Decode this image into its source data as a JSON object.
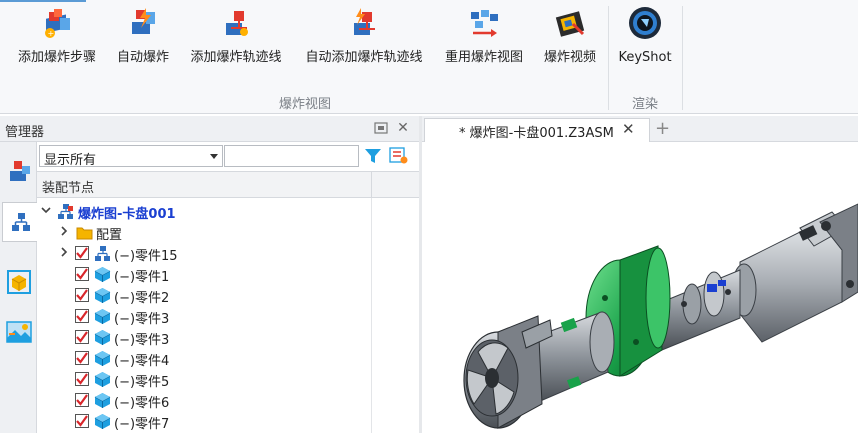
{
  "ribbon": {
    "buttons": [
      {
        "label": "添加爆炸步骤",
        "icon": "add-explode-step-icon"
      },
      {
        "label": "自动爆炸",
        "icon": "auto-explode-icon"
      },
      {
        "label": "添加爆炸轨迹线",
        "icon": "add-trail-line-icon"
      },
      {
        "label": "自动添加爆炸轨迹线",
        "icon": "auto-trail-line-icon"
      },
      {
        "label": "重用爆炸视图",
        "icon": "reuse-explode-view-icon"
      },
      {
        "label": "爆炸视频",
        "icon": "explode-video-icon"
      },
      {
        "label": "KeyShot",
        "icon": "keyshot-icon"
      }
    ],
    "groups": {
      "explode_view": "爆炸视图",
      "render": "渲染"
    }
  },
  "manager": {
    "title": "管理器",
    "filter_value": "显示所有",
    "search_value": "",
    "column_header": "装配节点",
    "tree": [
      {
        "label": "爆炸图-卡盘001",
        "type": "root",
        "expanded": true
      },
      {
        "label": "配置",
        "type": "folder",
        "expanded": false
      },
      {
        "label": "(−)零件15",
        "type": "subassembly",
        "expanded": false,
        "checked": true
      },
      {
        "label": "(−)零件1",
        "type": "part",
        "checked": true
      },
      {
        "label": "(−)零件2",
        "type": "part",
        "checked": true
      },
      {
        "label": "(−)零件3",
        "type": "part",
        "checked": true
      },
      {
        "label": "(−)零件3",
        "type": "part",
        "checked": true
      },
      {
        "label": "(−)零件4",
        "type": "part",
        "checked": true
      },
      {
        "label": "(−)零件5",
        "type": "part",
        "checked": true
      },
      {
        "label": "(−)零件6",
        "type": "part",
        "checked": true
      },
      {
        "label": "(−)零件7",
        "type": "part",
        "checked": true
      }
    ]
  },
  "document": {
    "tab_title": "* 爆炸图-卡盘001.Z3ASM",
    "add_tab": "+"
  },
  "colors": {
    "accent_blue": "#1a3fd1",
    "check_red": "#d9262b",
    "part_cube": "#1e9fe0",
    "model_green": "#19a24a"
  }
}
